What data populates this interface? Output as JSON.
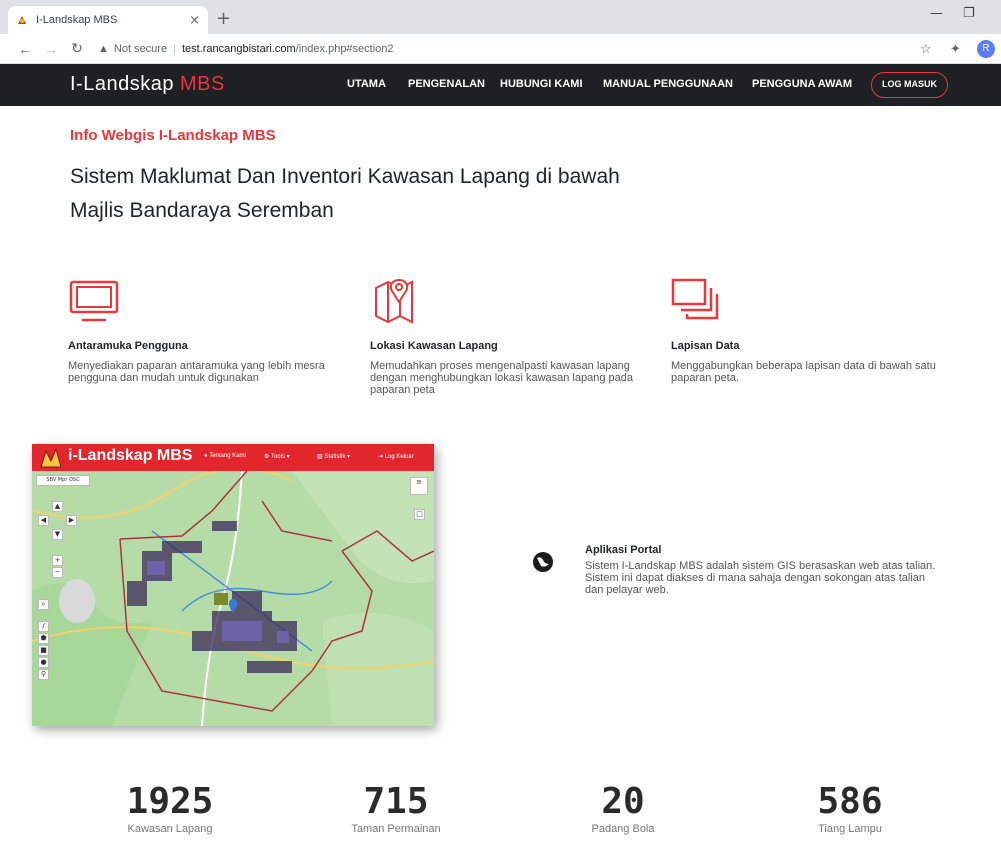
{
  "browser": {
    "tab_title": "I-Landskap MBS",
    "tab_close": "×",
    "new_tab": "+",
    "not_secure": "Not secure",
    "url_host": "test.rancangbistari.com",
    "url_path": "/index.php#section2",
    "profile_initial": "R",
    "icons": [
      "back-arrow-icon",
      "forward-arrow-icon",
      "reload-icon",
      "warning-icon",
      "star-icon",
      "extensions-icon"
    ]
  },
  "site": {
    "brand_main": "I-Landskap ",
    "brand_accent": "MBS",
    "nav": [
      "UTAMA",
      "PENGENALAN",
      "HUBUNGI KAMI",
      "MANUAL PENGGUNAAN",
      "PENGGUNA AWAM"
    ],
    "login": "LOG MASUK",
    "accent_color": "#e8373d",
    "nav_bg": "#1e2023"
  },
  "intro": {
    "subtitle": "Info Webgis I-Landskap MBS",
    "headline": "Sistem Maklumat Dan Inventori Kawasan Lapang di bawah Majlis Bandaraya Seremban"
  },
  "features": [
    {
      "icon": "monitor-icon",
      "title": "Antaramuka Pengguna",
      "desc": "Menyediakan paparan antaramuka yang lebih mesra pengguna dan mudah untuk digunakan"
    },
    {
      "icon": "map-pin-icon",
      "title": "Lokasi Kawasan Lapang",
      "desc": "Memudahkan proses mengenalpasti kawasan lapang dengan menghubungkan lokasi kawasan lapang pada paparan peta"
    },
    {
      "icon": "layers-icon",
      "title": "Lapisan Data",
      "desc": "Menggabungkan beberapa lapisan data di bawah satu paparan peta."
    }
  ],
  "map_preview": {
    "title": "i-Landskap MBS",
    "menu": [
      "Tentang Kami",
      "Tools",
      "Statistik",
      "Log Keluar"
    ],
    "layer_buttons": [
      "SBV",
      "Mpr",
      "OSC"
    ]
  },
  "portal": {
    "title": "Aplikasi Portal",
    "desc": "Sistem I-Landskap MBS adalah sistem GIS berasaskan web atas talian. Sistem ini dapat diakses di mana sahaja dengan sokongan atas talian dan pelayar web."
  },
  "stats": [
    {
      "value": "1925",
      "label": "Kawasan Lapang"
    },
    {
      "value": "715",
      "label": "Taman Permainan"
    },
    {
      "value": "20",
      "label": "Padang Bola"
    },
    {
      "value": "586",
      "label": "Tiang Lampu"
    }
  ]
}
